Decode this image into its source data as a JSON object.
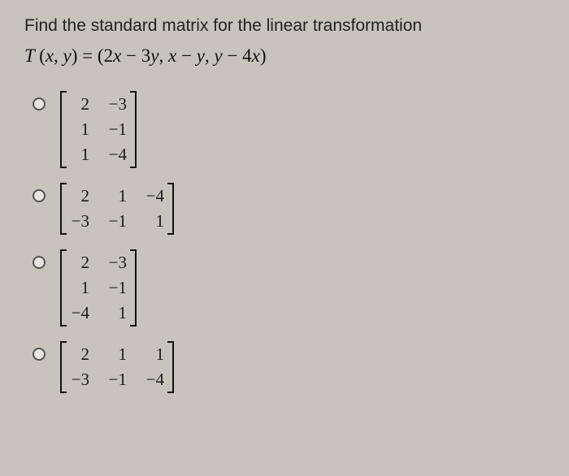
{
  "question": "Find the standard matrix for the linear transformation",
  "equation_display": "T (x, y) = (2x − 3y, x − y, y − 4x)",
  "options": [
    {
      "id": "opt-a",
      "rows": 3,
      "cols": 2,
      "values": [
        "2",
        "−3",
        "1",
        "−1",
        "1",
        "−4"
      ]
    },
    {
      "id": "opt-b",
      "rows": 2,
      "cols": 3,
      "values": [
        "2",
        "1",
        "−4",
        "−3",
        "−1",
        "1"
      ]
    },
    {
      "id": "opt-c",
      "rows": 3,
      "cols": 2,
      "values": [
        "2",
        "−3",
        "1",
        "−1",
        "−4",
        "1"
      ]
    },
    {
      "id": "opt-d",
      "rows": 2,
      "cols": 3,
      "values": [
        "2",
        "1",
        "1",
        "−3",
        "−1",
        "−4"
      ]
    }
  ]
}
